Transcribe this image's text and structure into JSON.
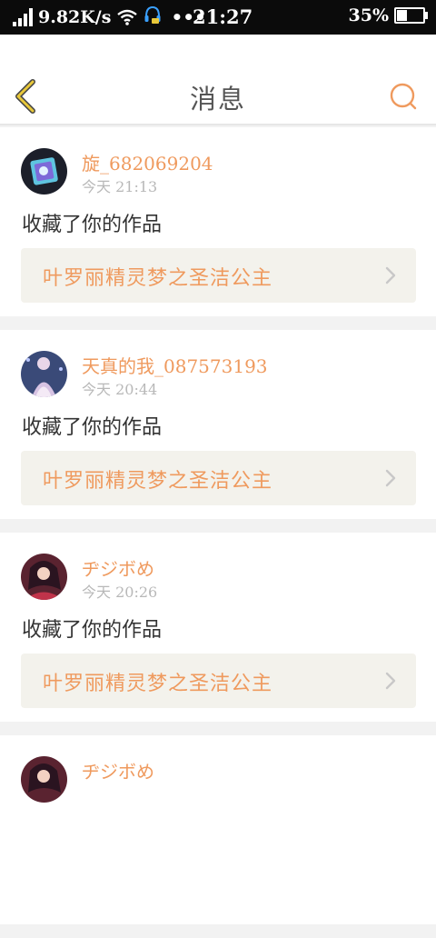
{
  "status_bar": {
    "speed": "9.82K/s",
    "time": "21:27",
    "battery": "35%",
    "battery_level": 0.35,
    "icons": [
      "signal-icon",
      "wifi-icon",
      "headset-icon",
      "more-dots-icon",
      "battery-icon"
    ]
  },
  "header": {
    "title": "消息",
    "back_icon": "chevron-left-icon",
    "search_icon": "search-icon",
    "accent_color": "#ef9a5e",
    "back_color": "#e8c83a"
  },
  "messages": [
    {
      "username": "旋_682069204",
      "time": "今天 21:13",
      "action": "收藏了你的作品",
      "work_title": "叶罗丽精灵梦之圣洁公主"
    },
    {
      "username": "天真的我_087573193",
      "time": "今天 20:44",
      "action": "收藏了你的作品",
      "work_title": "叶罗丽精灵梦之圣洁公主"
    },
    {
      "username": "ヂジボめ",
      "time": "今天 20:26",
      "action": "收藏了你的作品",
      "work_title": "叶罗丽精灵梦之圣洁公主"
    },
    {
      "username": "ヂジボめ",
      "time": "",
      "action": "",
      "work_title": ""
    }
  ]
}
